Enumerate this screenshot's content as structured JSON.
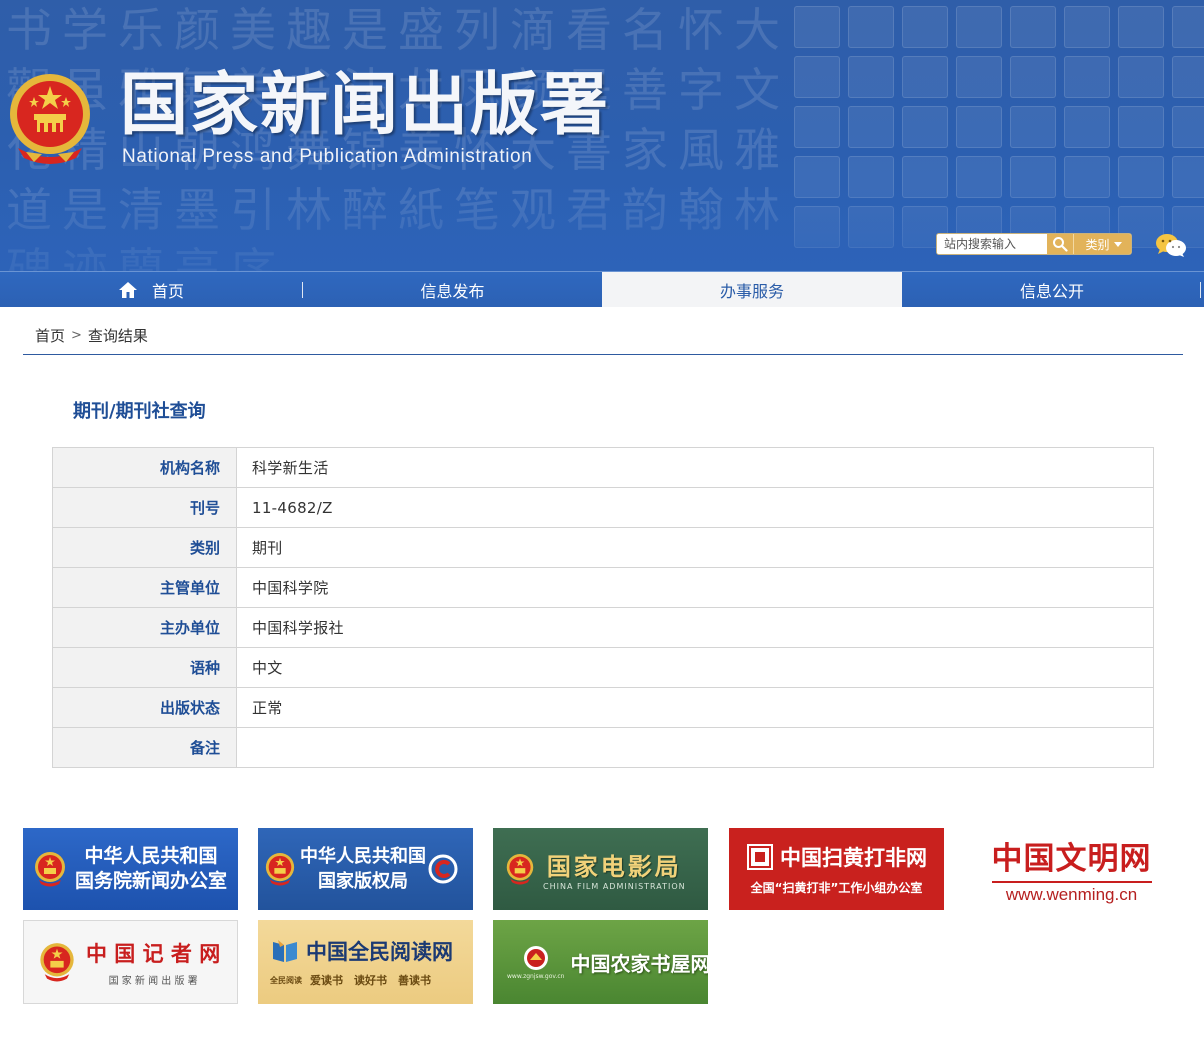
{
  "header": {
    "title": "国家新闻出版署",
    "subtitle": "National  Press and Publication Administration",
    "search_placeholder": "站内搜索输入",
    "category_label": "类别",
    "colors": {
      "banner_blue": "#2c5fb0",
      "accent_gold": "#e2b35a"
    }
  },
  "nav": {
    "items": [
      {
        "label": "首页",
        "icon": "home-icon"
      },
      {
        "label": "信息发布"
      },
      {
        "label": "办事服务",
        "active": true
      },
      {
        "label": "信息公开"
      }
    ]
  },
  "breadcrumb": {
    "home": "首页",
    "sep": ">",
    "current": "查询结果"
  },
  "query": {
    "title": "期刊/期刊社查询",
    "rows": [
      {
        "label": "机构名称",
        "value": "科学新生活"
      },
      {
        "label": "刊号",
        "value": "11-4682/Z"
      },
      {
        "label": "类别",
        "value": "期刊"
      },
      {
        "label": "主管单位",
        "value": "中国科学院"
      },
      {
        "label": "主办单位",
        "value": "中国科学报社"
      },
      {
        "label": "语种",
        "value": "中文"
      },
      {
        "label": "出版状态",
        "value": "正常"
      },
      {
        "label": "备注",
        "value": ""
      }
    ]
  },
  "links": {
    "scio": {
      "line1": "中华人民共和国",
      "line2": "国务院新闻办公室"
    },
    "ncac": {
      "line1": "中华人民共和国",
      "line2": "国家版权局"
    },
    "film": {
      "main": "国家电影局",
      "sub": "CHINA FILM ADMINISTRATION"
    },
    "shdf": {
      "main": "中国扫黄打非网",
      "sub": "全国“扫黄打非”工作小组办公室"
    },
    "wenming": {
      "main": "中国文明网",
      "sub": "www.wenming.cn"
    },
    "journalist": {
      "main": "中 国 记 者 网",
      "sub": "国 家 新 闻 出 版 署"
    },
    "reading": {
      "main": "中国全民阅读网",
      "badge": "全民阅读",
      "sub": "爱读书　读好书　善读书"
    },
    "farm": {
      "main": "中国农家书屋网",
      "small": "www.zgnjsw.gov.cn"
    }
  }
}
